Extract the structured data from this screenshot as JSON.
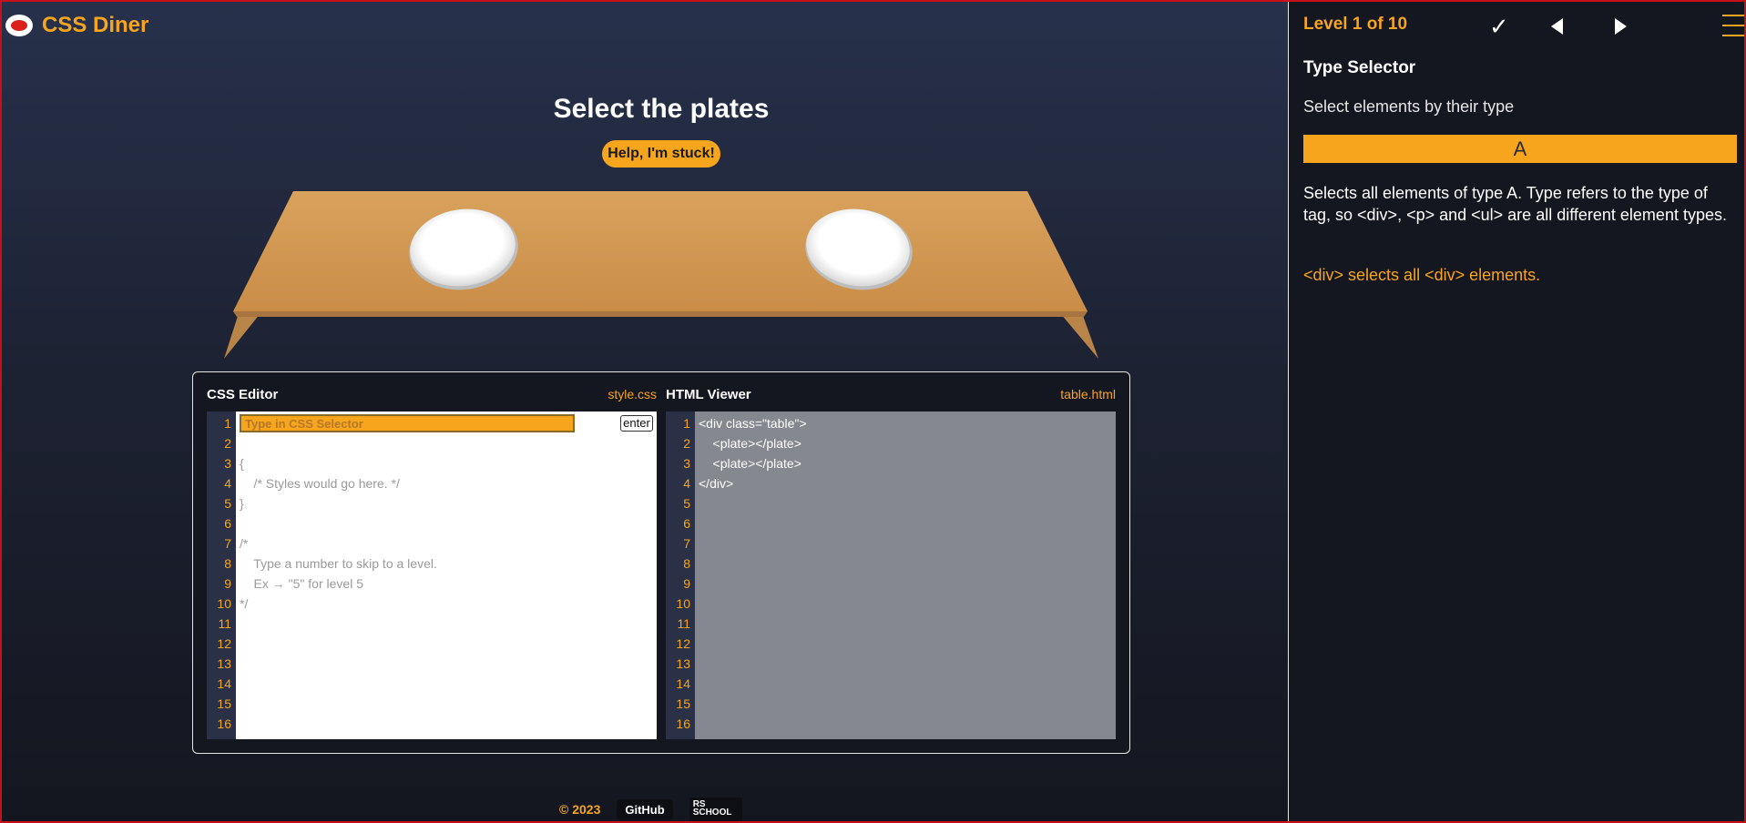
{
  "app": {
    "title": "CSS Diner"
  },
  "level": {
    "instruction": "Select the plates",
    "help_button": "Help, I'm stuck!"
  },
  "css_editor": {
    "title": "CSS Editor",
    "file": "style.css",
    "input_placeholder": "Type in CSS Selector",
    "enter_label": "enter",
    "line_numbers": [
      "1",
      "2",
      "3",
      "4",
      "5",
      "6",
      "7",
      "8",
      "9",
      "10",
      "11",
      "12",
      "13",
      "14",
      "15",
      "16"
    ],
    "lines": [
      "",
      "",
      "{",
      "    /* Styles would go here. */",
      "}",
      "",
      "/*",
      "    Type a number to skip to a level.",
      "    Ex → \"5\" for level 5",
      "*/"
    ]
  },
  "html_viewer": {
    "title": "HTML Viewer",
    "file": "table.html",
    "line_numbers": [
      "1",
      "2",
      "3",
      "4",
      "5",
      "6",
      "7",
      "8",
      "9",
      "10",
      "11",
      "12",
      "13",
      "14",
      "15",
      "16"
    ],
    "lines": [
      "<div class=\"table\">",
      "    <plate></plate>",
      "    <plate></plate>",
      "</div>"
    ]
  },
  "footer": {
    "copyright": "© 2023",
    "github": "GitHub",
    "rs_school": "RS SCHOOL"
  },
  "sidebar": {
    "level_indicator": "Level 1 of 10",
    "check_symbol": "✓",
    "selector_name": "Type Selector",
    "selector_description": "Select elements by their type",
    "syntax": "A",
    "hint": "Selects all elements of type A. Type refers to the type of tag, so <div>, <p> and <ul> are all different element types.",
    "example": "<div> selects all <div> elements."
  },
  "colors": {
    "accent": "#f7a51d",
    "table_wood": "#d29a55",
    "sidebar_bg": "#141620",
    "html_viewer_bg": "#85888e"
  },
  "icons": [
    "css-diner-logo-icon",
    "check-icon",
    "prev-level-icon",
    "next-level-icon",
    "menu-icon",
    "rs-school-logo"
  ]
}
